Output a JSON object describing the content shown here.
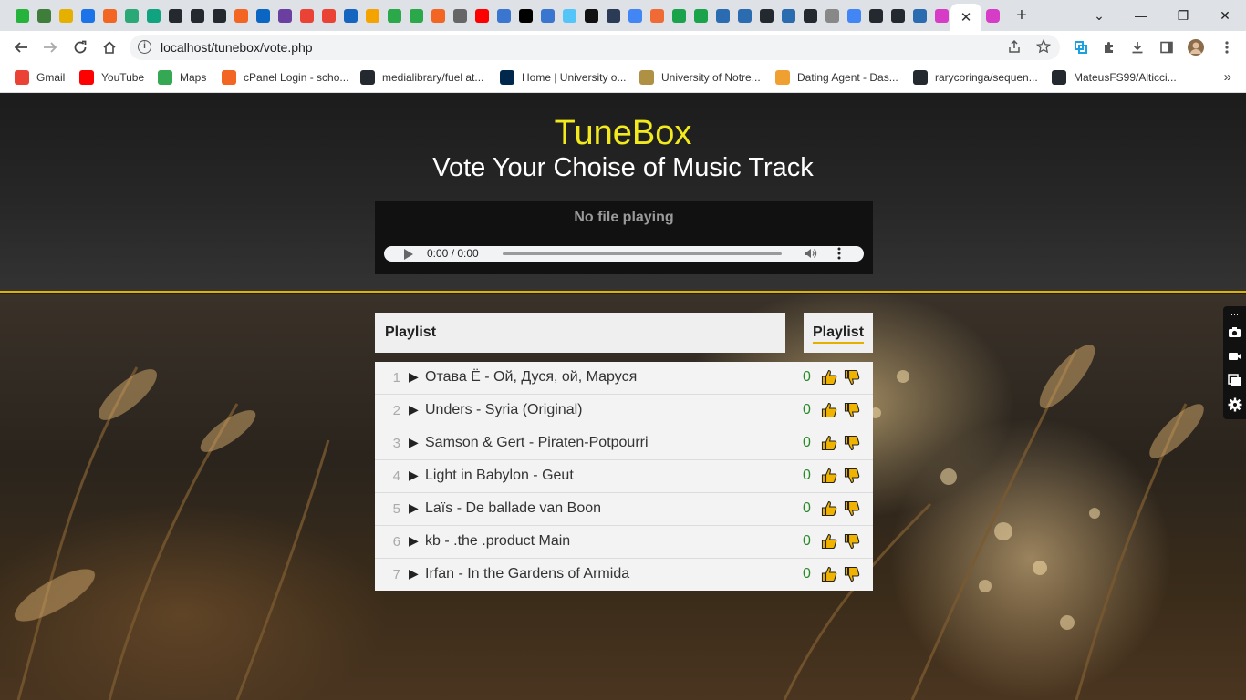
{
  "browser": {
    "tab_favicons": [
      "#25b33b",
      "#3e7d3a",
      "#e6b000",
      "#1a73e8",
      "#f26522",
      "#2aa876",
      "#10a37f",
      "#24292f",
      "#24292f",
      "#24292f",
      "#f26522",
      "#0a66c2",
      "#6b3fa0",
      "#ea4335",
      "#ea4335",
      "#1565c0",
      "#f4a300",
      "#2aa84a",
      "#2aa84a",
      "#f26522",
      "#666666",
      "#ff0000",
      "#3a76d0",
      "#000000",
      "#3a76d0",
      "#54c5f8",
      "#111111",
      "#2b3a55",
      "#4285f4",
      "#f06a35",
      "#1aa34a",
      "#1aa34a",
      "#2b6cb0",
      "#2b6cb0",
      "#24292f",
      "#2b6cb0",
      "#24292f",
      "#888888",
      "#4285f4",
      "#24292f",
      "#24292f",
      "#2b6cb0",
      "#d63cc6"
    ],
    "active_tab_close": "✕",
    "new_tab": "+",
    "window_controls": [
      "⌄",
      "—",
      "❐",
      "✕"
    ],
    "url": "localhost/tunebox/vote.php",
    "info_icon": "i",
    "bookmarks": [
      {
        "label": "Gmail",
        "color": "#ea4335"
      },
      {
        "label": "YouTube",
        "color": "#ff0000"
      },
      {
        "label": "Maps",
        "color": "#34a853"
      },
      {
        "label": "cPanel Login - scho...",
        "color": "#f26522"
      },
      {
        "label": "medialibrary/fuel at...",
        "color": "#24292f"
      },
      {
        "label": "Home | University o...",
        "color": "#00274c"
      },
      {
        "label": "University of Notre...",
        "color": "#ae9142"
      },
      {
        "label": "Dating Agent - Das...",
        "color": "#f0a030"
      },
      {
        "label": "rarycoringa/sequen...",
        "color": "#24292f"
      },
      {
        "label": "MateusFS99/Alticci...",
        "color": "#24292f"
      }
    ],
    "bookmarks_more": "»"
  },
  "header": {
    "title": "TuneBox",
    "subtitle": "Vote Your Choise of Music Track"
  },
  "player": {
    "status": "No file playing",
    "time": "0:00 / 0:00"
  },
  "playlist": {
    "heading": "Playlist",
    "tab_label": "Playlist",
    "tracks": [
      {
        "num": "1",
        "name": "Отава Ё - Ой, Дуся, ой, Маруся",
        "score": "0"
      },
      {
        "num": "2",
        "name": "Unders - Syria (Original)",
        "score": "0"
      },
      {
        "num": "3",
        "name": "Samson & Gert - Piraten-Potpourri",
        "score": "0"
      },
      {
        "num": "4",
        "name": "Light in Babylon - Geut",
        "score": "0"
      },
      {
        "num": "5",
        "name": "Laïs - De ballade van Boon",
        "score": "0"
      },
      {
        "num": "6",
        "name": "kb - .the .product Main",
        "score": "0"
      },
      {
        "num": "7",
        "name": "Irfan - In the Gardens of Armida",
        "score": "0"
      }
    ]
  },
  "colors": {
    "title": "#f2ea1c",
    "accent": "#e2b000",
    "thumb": "#f0b400",
    "score": "#2a8a2a"
  }
}
